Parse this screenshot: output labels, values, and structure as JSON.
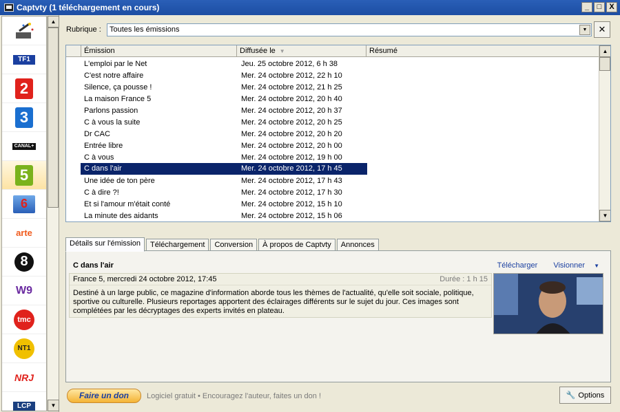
{
  "window": {
    "title": "Captvty (1 téléchargement en cours)",
    "buttons": [
      "_",
      "□",
      "X"
    ]
  },
  "channels": [
    {
      "name": "wizard",
      "label": ""
    },
    {
      "name": "tf1",
      "label": "TF1"
    },
    {
      "name": "france2",
      "label": "2"
    },
    {
      "name": "france3",
      "label": "3"
    },
    {
      "name": "canalplus",
      "label": "CANAL+"
    },
    {
      "name": "france5",
      "label": "5"
    },
    {
      "name": "m6",
      "label": "6"
    },
    {
      "name": "arte",
      "label": "arte"
    },
    {
      "name": "d8",
      "label": "8"
    },
    {
      "name": "w9",
      "label": "W9"
    },
    {
      "name": "tmc",
      "label": "tmc"
    },
    {
      "name": "nt1",
      "label": "NT1"
    },
    {
      "name": "nrj12",
      "label": "NRJ"
    },
    {
      "name": "lcp",
      "label": "LCP"
    }
  ],
  "filter": {
    "label": "Rubrique :",
    "value": "Toutes les émissions"
  },
  "list": {
    "headers": [
      "Émission",
      "Diffusée le",
      "Résumé"
    ],
    "rows": [
      {
        "emission": "L'emploi par le Net",
        "date": "Jeu. 25 octobre 2012, 6 h 38"
      },
      {
        "emission": "C'est notre affaire",
        "date": "Mer. 24 octobre 2012, 22 h 10"
      },
      {
        "emission": "Silence, ça pousse !",
        "date": "Mer. 24 octobre 2012, 21 h 25"
      },
      {
        "emission": "La maison France 5",
        "date": "Mer. 24 octobre 2012, 20 h 40"
      },
      {
        "emission": "Parlons passion",
        "date": "Mer. 24 octobre 2012, 20 h 37"
      },
      {
        "emission": "C à vous la suite",
        "date": "Mer. 24 octobre 2012, 20 h 25"
      },
      {
        "emission": "Dr CAC",
        "date": "Mer. 24 octobre 2012, 20 h 20"
      },
      {
        "emission": "Entrée libre",
        "date": "Mer. 24 octobre 2012, 20 h 00"
      },
      {
        "emission": "C à vous",
        "date": "Mer. 24 octobre 2012, 19 h 00"
      },
      {
        "emission": "C dans l'air",
        "date": "Mer. 24 octobre 2012, 17 h 45",
        "selected": true
      },
      {
        "emission": "Une idée de ton père",
        "date": "Mer. 24 octobre 2012, 17 h 43"
      },
      {
        "emission": "C à dire ?!",
        "date": "Mer. 24 octobre 2012, 17 h 30"
      },
      {
        "emission": "Et si l'amour m'était conté",
        "date": "Mer. 24 octobre 2012, 15 h 10"
      },
      {
        "emission": "La minute des aidants",
        "date": "Mer. 24 octobre 2012, 15 h 06"
      }
    ]
  },
  "tabs": [
    {
      "label": "Détails sur l'émission",
      "active": true
    },
    {
      "label": "Téléchargement"
    },
    {
      "label": "Conversion"
    },
    {
      "label": "À propos de Captvty"
    },
    {
      "label": "Annonces"
    }
  ],
  "details": {
    "title": "C dans l'air",
    "download_label": "Télécharger",
    "view_label": "Visionner",
    "broadcast": "France 5, mercredi 24 octobre 2012, 17:45",
    "duration": "Durée : 1 h 15",
    "description": "Destiné à un large public, ce magazine d'information aborde tous les thèmes de l'actualité, qu'elle soit sociale, politique, sportive ou culturelle. Plusieurs reportages apportent des éclairages différents sur le sujet du jour. Ces images sont complétées par les décryptages des experts invités en plateau."
  },
  "footer": {
    "donate_label": "Faire un don",
    "text": "Logiciel gratuit  •  Encouragez l'auteur, faites un don !",
    "options_label": "Options"
  }
}
